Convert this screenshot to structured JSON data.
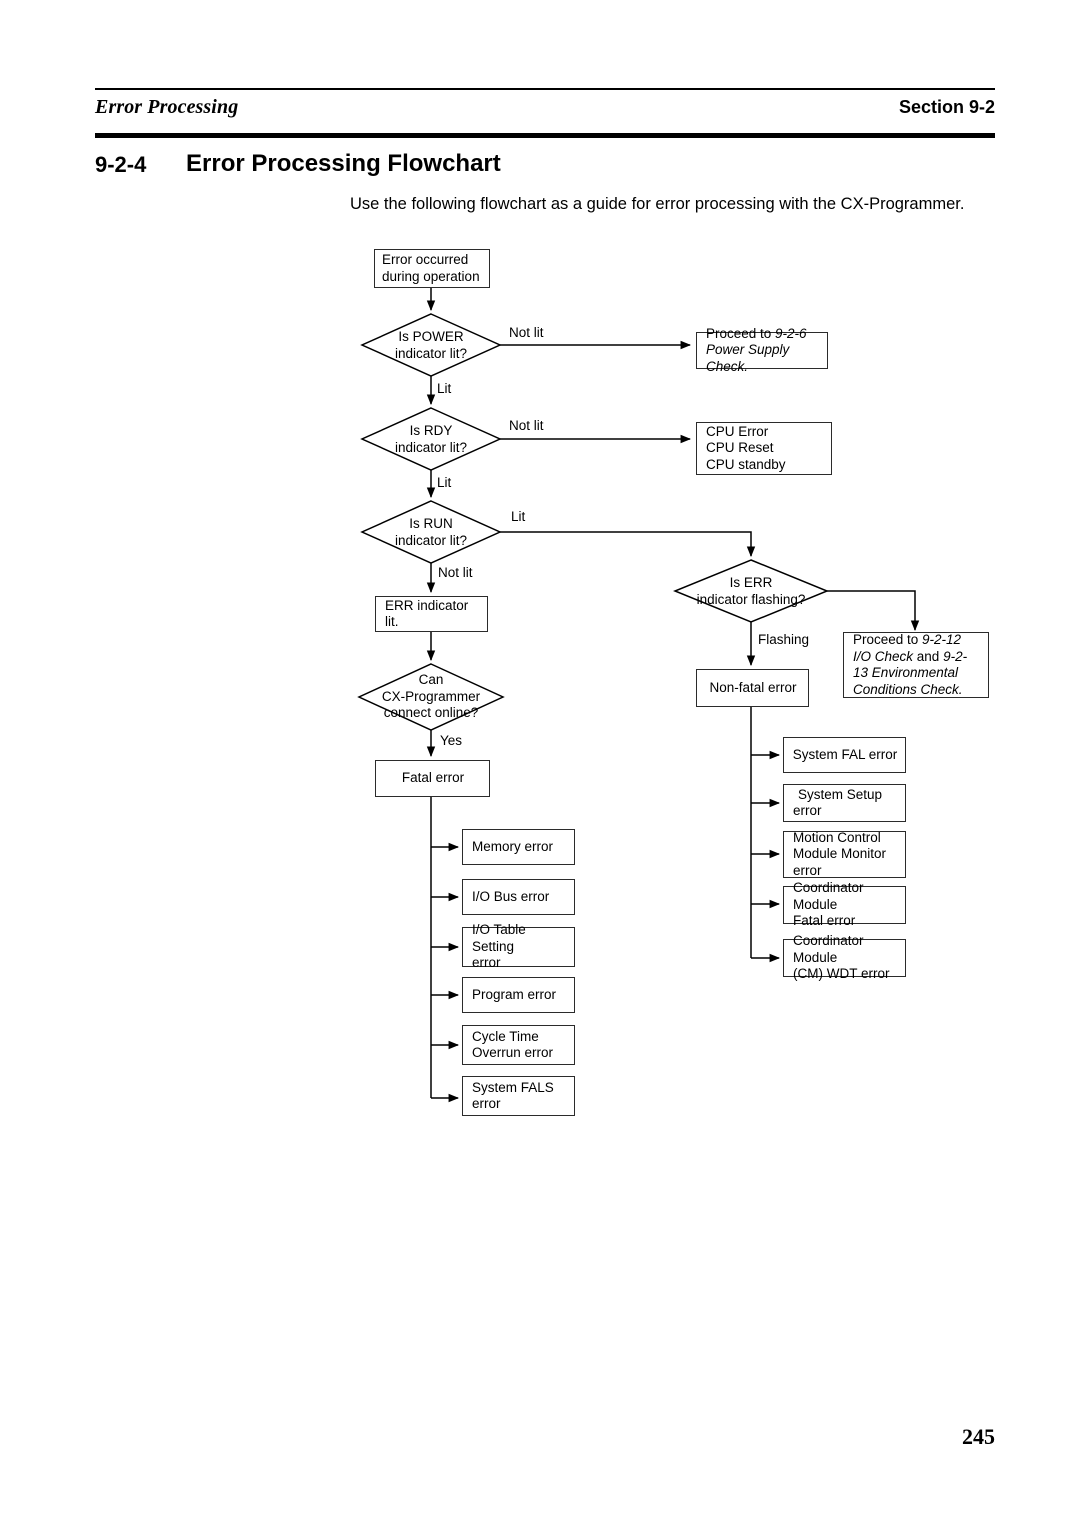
{
  "header": {
    "left_title": "Error Processing",
    "right_title": "Section 9-2"
  },
  "section": {
    "number": "9-2-4",
    "title": "Error Processing Flowchart"
  },
  "intro": "Use the following flowchart as a guide for error processing with the CX-Programmer.",
  "page_number": "245",
  "flowchart": {
    "start": {
      "line1": "Error occurred",
      "line2": "during operation"
    },
    "decisions": {
      "power": {
        "line1": "Is POWER",
        "line2": "indicator lit?"
      },
      "rdy": {
        "line1": "Is RDY",
        "line2": "indicator lit?"
      },
      "run": {
        "line1": "Is RUN",
        "line2": "indicator lit?"
      },
      "err": {
        "line1": "Is ERR",
        "line2": "indicator flashing?"
      },
      "cx": {
        "line1": "Can",
        "line2": "CX-Programmer",
        "line3": "connect online?"
      }
    },
    "edge_labels": {
      "power_not_lit": "Not lit",
      "power_lit": "Lit",
      "rdy_not_lit": "Not lit",
      "rdy_lit": "Lit",
      "run_lit": "Lit",
      "run_not_lit": "Not lit",
      "err_flashing": "Flashing",
      "cx_yes": "Yes"
    },
    "power_supply_ref": {
      "lead": "Proceed to ",
      "ref": "9-2-6",
      "title": "Power Supply Check."
    },
    "cpu_box": {
      "line1": "CPU Error",
      "line2": "CPU Reset",
      "line3": "CPU standby"
    },
    "io_env_ref": {
      "lead": "Proceed to ",
      "ref1": "9-2-12  I/O Check",
      "conj": " and ",
      "ref2": "9-2-13 Environmental Conditions Check."
    },
    "err_indicator_lit": "ERR indicator lit.",
    "fatal_error": "Fatal error",
    "non_fatal_error": "Non-fatal error",
    "fatal_list": [
      {
        "line1": "Memory error",
        "line2": ""
      },
      {
        "line1": "I/O Bus error",
        "line2": ""
      },
      {
        "line1": "I/O Table Setting",
        "line2": "error"
      },
      {
        "line1": "Program error",
        "line2": ""
      },
      {
        "line1": "Cycle Time",
        "line2": "Overrun error"
      },
      {
        "line1": "System FALS",
        "line2": "error"
      }
    ],
    "non_fatal_list": [
      {
        "line1": "System FAL error",
        "line2": "",
        "line3": ""
      },
      {
        "line1": "System Setup",
        "line2": "error",
        "line3": ""
      },
      {
        "line1": "Motion Control",
        "line2": "Module Monitor",
        "line3": "error"
      },
      {
        "line1": "Coordinator Module",
        "line2": "Fatal error",
        "line3": ""
      },
      {
        "line1": "Coordinator Module",
        "line2": "(CM) WDT error",
        "line3": ""
      }
    ]
  }
}
